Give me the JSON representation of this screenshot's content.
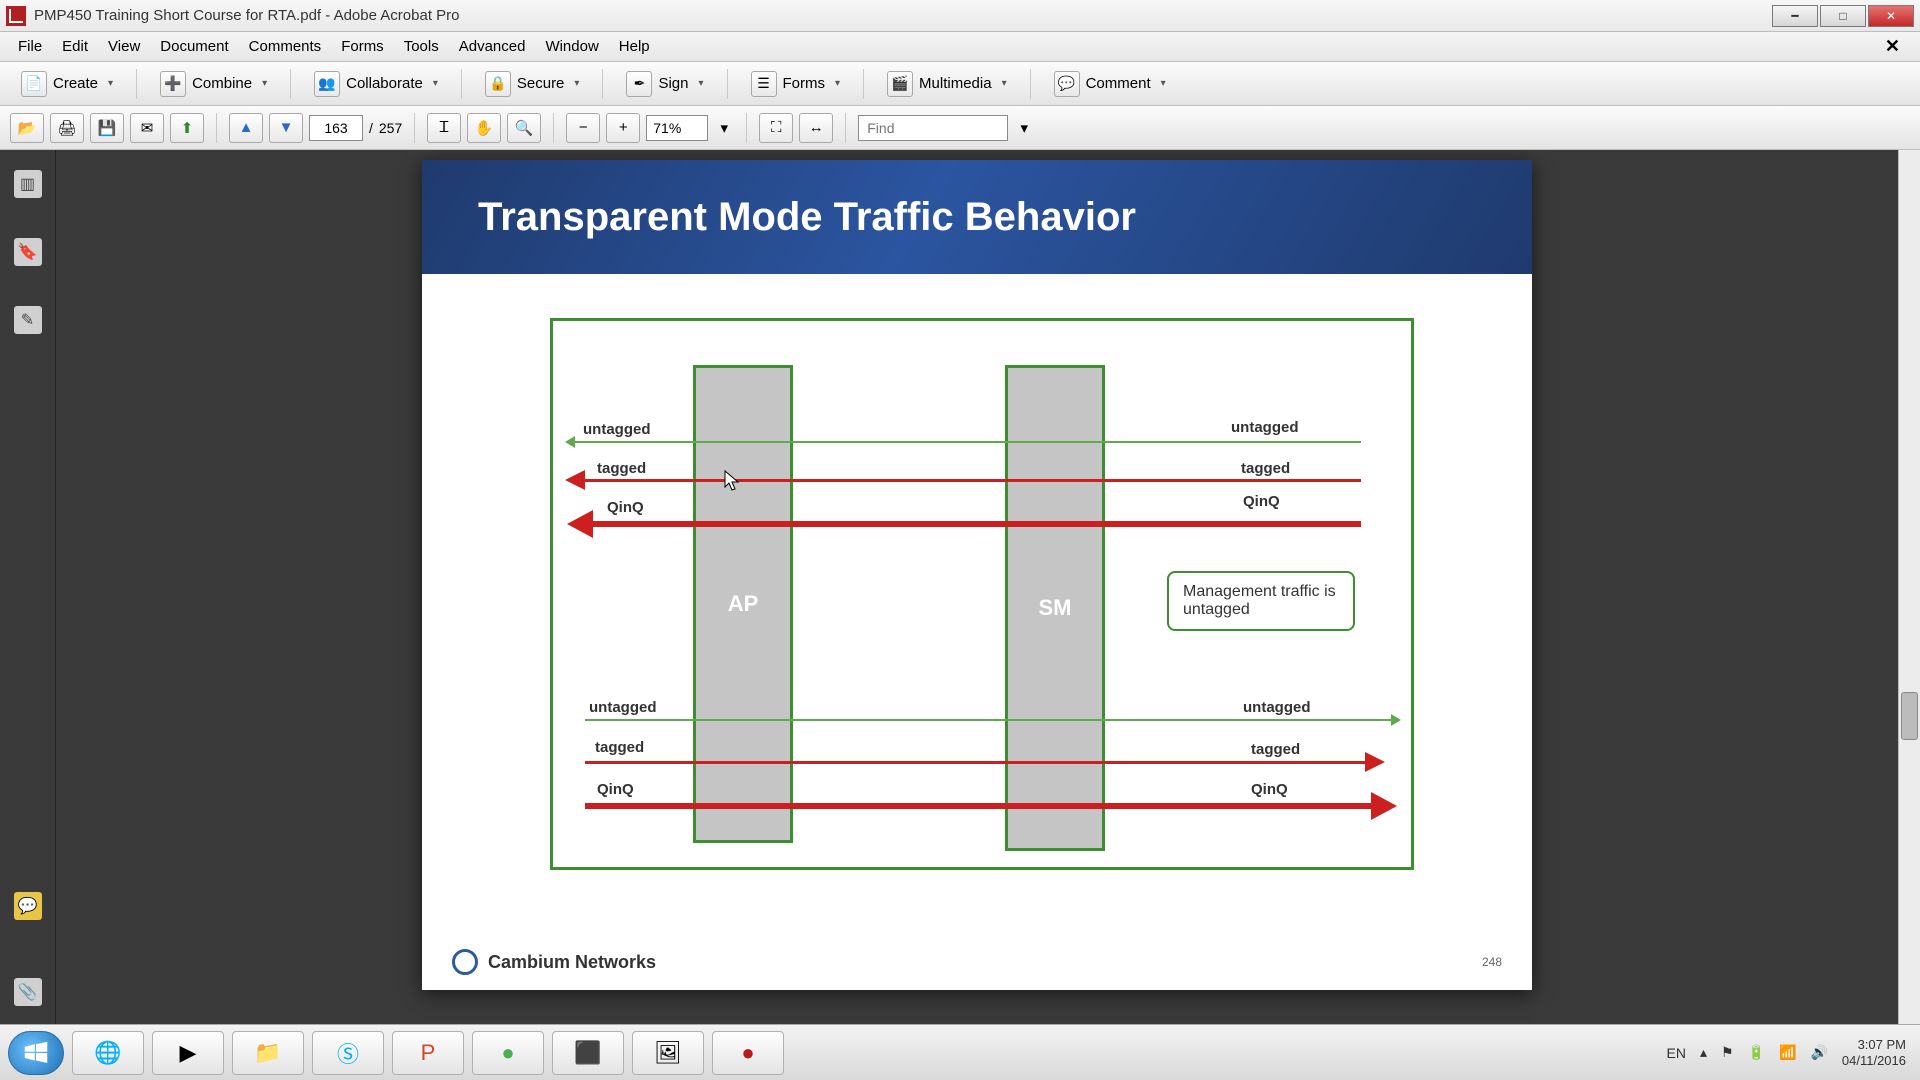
{
  "window": {
    "title": "PMP450 Training Short Course for RTA.pdf - Adobe Acrobat Pro"
  },
  "menu": {
    "items": [
      "File",
      "Edit",
      "View",
      "Document",
      "Comments",
      "Forms",
      "Tools",
      "Advanced",
      "Window",
      "Help"
    ]
  },
  "toolbar1": {
    "create": "Create",
    "combine": "Combine",
    "collaborate": "Collaborate",
    "secure": "Secure",
    "sign": "Sign",
    "forms": "Forms",
    "multimedia": "Multimedia",
    "comment": "Comment"
  },
  "toolbar2": {
    "page_current": "163",
    "page_sep": "/",
    "page_total": "257",
    "zoom": "71%",
    "find_placeholder": "Find"
  },
  "slide": {
    "title": "Transparent Mode Traffic Behavior",
    "ap_label": "AP",
    "sm_label": "SM",
    "top_left": {
      "untagged": "untagged",
      "tagged": "tagged",
      "qinq": "QinQ"
    },
    "top_right": {
      "untagged": "untagged",
      "tagged": "tagged",
      "qinq": "QinQ"
    },
    "bot_left": {
      "untagged": "untagged",
      "tagged": "tagged",
      "qinq": "QinQ"
    },
    "bot_right": {
      "untagged": "untagged",
      "tagged": "tagged",
      "qinq": "QinQ"
    },
    "callout": "Management traffic is untagged",
    "brand": "Cambium Networks",
    "page_number": "248"
  },
  "systray": {
    "lang": "EN",
    "time": "3:07 PM",
    "date": "04/11/2016"
  }
}
